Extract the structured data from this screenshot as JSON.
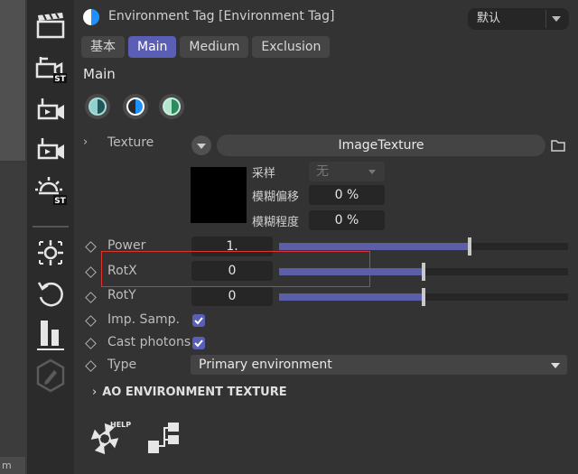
{
  "left_strip": {
    "bottom_label": "m"
  },
  "toolbar": {
    "items": [
      {
        "name": "clapper-icon"
      },
      {
        "name": "stage-camera-st-icon",
        "badge": "ST"
      },
      {
        "name": "motion-camera-icon"
      },
      {
        "name": "camera-tracker-icon"
      },
      {
        "name": "light-st-icon",
        "badge": "ST"
      },
      {
        "name": "target-icon"
      },
      {
        "name": "reset-rotate-icon"
      },
      {
        "name": "bar-chart-icon"
      },
      {
        "name": "edit-disabled-icon"
      }
    ]
  },
  "header": {
    "title": "Environment Tag [Environment Tag]",
    "preset_value": "默认"
  },
  "tabs": [
    {
      "label": "基本",
      "active": false
    },
    {
      "label": "Main",
      "active": true
    },
    {
      "label": "Medium",
      "active": false
    },
    {
      "label": "Exclusion",
      "active": false
    }
  ],
  "section": {
    "title": "Main"
  },
  "modes": [
    {
      "name": "mode-half-teal-icon"
    },
    {
      "name": "mode-half-blue-icon"
    },
    {
      "name": "mode-half-green-icon"
    }
  ],
  "texture": {
    "label": "Texture",
    "value": "ImageTexture",
    "sampling_label": "采样",
    "sampling_value": "无",
    "blur_offset_label": "模糊偏移",
    "blur_offset_value": "0 %",
    "blur_amount_label": "模糊程度",
    "blur_amount_value": "0 %"
  },
  "params": {
    "power": {
      "label": "Power",
      "value": "1.",
      "slider_fraction": 0.66
    },
    "rotx": {
      "label": "RotX",
      "value": "0",
      "slider_fraction": 0.5
    },
    "roty": {
      "label": "RotY",
      "value": "0",
      "slider_fraction": 0.5
    },
    "imp_samp": {
      "label": "Imp. Samp.",
      "checked": true
    },
    "cast_photons": {
      "label": "Cast photons",
      "checked": true
    },
    "type": {
      "label": "Type",
      "value": "Primary environment"
    }
  },
  "ao_group": {
    "title": "AO ENVIRONMENT TEXTURE"
  },
  "footer": {
    "help_badge": "HELP"
  },
  "colors": {
    "accent": "#5a5fb5",
    "highlight_box": "#e0332f"
  }
}
